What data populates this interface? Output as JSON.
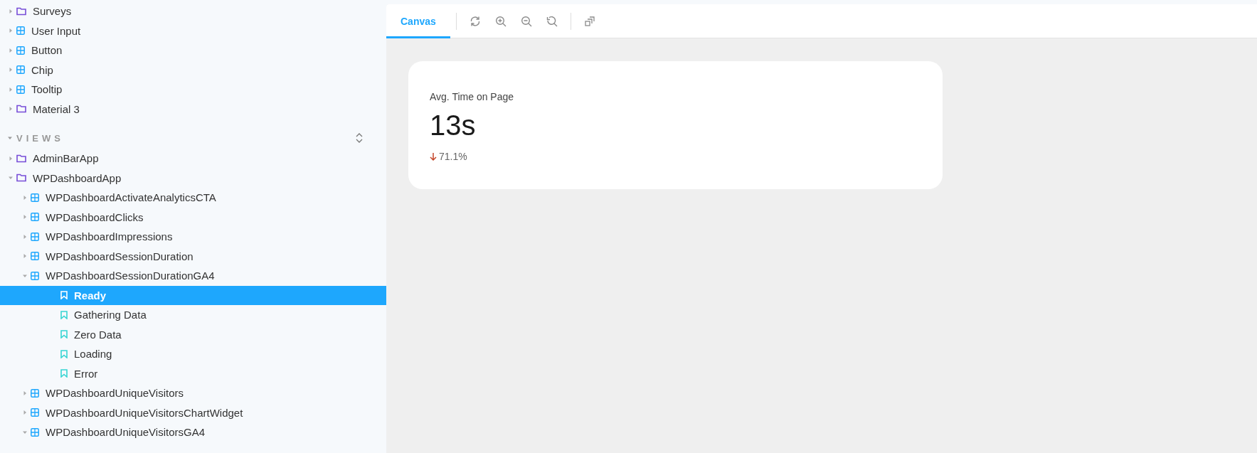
{
  "sidebar": {
    "tree": [
      {
        "kind": "folder",
        "label": "Surveys",
        "expanded": false,
        "selected": false
      },
      {
        "kind": "component",
        "label": "User Input",
        "expanded": false,
        "selected": false
      },
      {
        "kind": "component",
        "label": "Button",
        "expanded": false,
        "selected": false
      },
      {
        "kind": "component",
        "label": "Chip",
        "expanded": false,
        "selected": false
      },
      {
        "kind": "component",
        "label": "Tooltip",
        "expanded": false,
        "selected": false
      },
      {
        "kind": "folder",
        "label": "Material 3",
        "expanded": false,
        "selected": false
      }
    ],
    "section": {
      "title": "VIEWS",
      "expanded": true,
      "items": [
        {
          "kind": "folder",
          "label": "AdminBarApp",
          "expanded": false,
          "selected": false
        },
        {
          "kind": "folder",
          "label": "WPDashboardApp",
          "expanded": true,
          "selected": false,
          "children": [
            {
              "kind": "component",
              "label": "WPDashboardActivateAnalyticsCTA",
              "expanded": false,
              "selected": false
            },
            {
              "kind": "component",
              "label": "WPDashboardClicks",
              "expanded": false,
              "selected": false
            },
            {
              "kind": "component",
              "label": "WPDashboardImpressions",
              "expanded": false,
              "selected": false
            },
            {
              "kind": "component",
              "label": "WPDashboardSessionDuration",
              "expanded": false,
              "selected": false
            },
            {
              "kind": "component",
              "label": "WPDashboardSessionDurationGA4",
              "expanded": true,
              "selected": false,
              "children": [
                {
                  "kind": "story",
                  "label": "Ready",
                  "selected": true
                },
                {
                  "kind": "story",
                  "label": "Gathering Data",
                  "selected": false
                },
                {
                  "kind": "story",
                  "label": "Zero Data",
                  "selected": false
                },
                {
                  "kind": "story",
                  "label": "Loading",
                  "selected": false
                },
                {
                  "kind": "story",
                  "label": "Error",
                  "selected": false
                }
              ]
            },
            {
              "kind": "component",
              "label": "WPDashboardUniqueVisitors",
              "expanded": false,
              "selected": false
            },
            {
              "kind": "component",
              "label": "WPDashboardUniqueVisitorsChartWidget",
              "expanded": false,
              "selected": false
            },
            {
              "kind": "component",
              "label": "WPDashboardUniqueVisitorsGA4",
              "expanded": true,
              "selected": false
            }
          ]
        }
      ]
    }
  },
  "toolbar": {
    "tabs": [
      {
        "label": "Canvas",
        "selected": true
      }
    ]
  },
  "card": {
    "label": "Avg. Time on Page",
    "value": "13s",
    "change": "71.1%"
  }
}
